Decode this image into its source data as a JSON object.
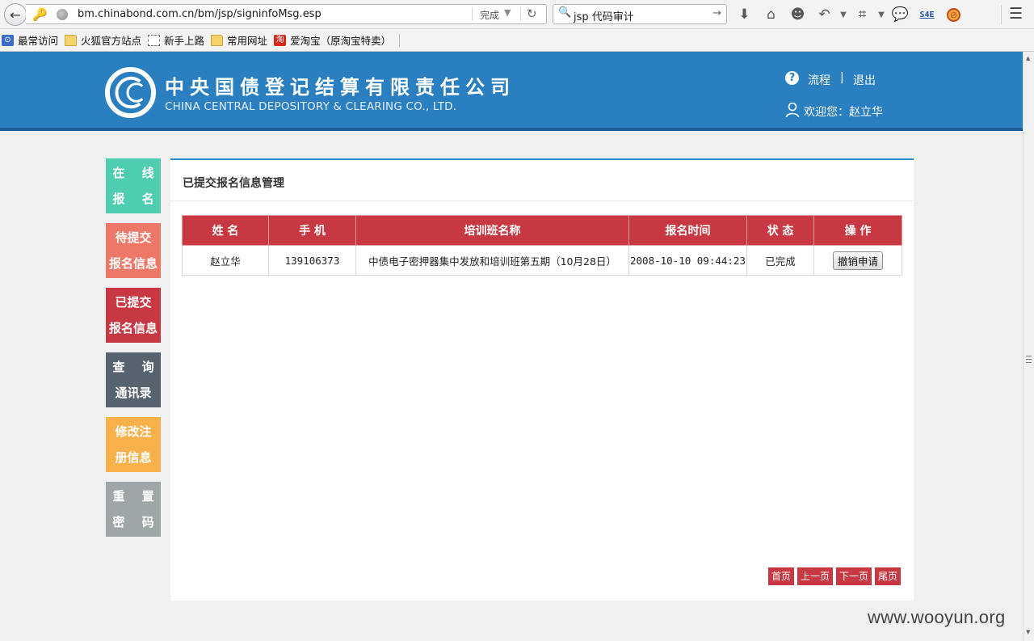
{
  "browser": {
    "url": "bm.chinabond.com.cn/bm/jsp/signinfoMsg.esp",
    "status": "完成",
    "search": "jsp 代码审计",
    "icons": [
      "download-icon",
      "home-icon",
      "chat-bubble-icon",
      "undo-icon",
      "crop-icon",
      "speech-icon",
      "s4e-icon",
      "adblock-icon",
      "menu-icon"
    ],
    "s4e_label": "S4E"
  },
  "bookmarks": [
    {
      "label": "最常访问",
      "icon": "most-visited-icon"
    },
    {
      "label": "火狐官方站点",
      "icon": "folder-icon"
    },
    {
      "label": "新手上路",
      "icon": "page-icon"
    },
    {
      "label": "常用网址",
      "icon": "folder-icon"
    },
    {
      "label": "爱淘宝（原淘宝特卖）",
      "icon": "taobao-icon"
    }
  ],
  "header": {
    "company_cn": "中央国债登记结算有限责任公司",
    "company_en": "CHINA CENTRAL DEPOSITORY & CLEARING CO., LTD.",
    "help_icon_text": "?",
    "flow_link": "流程",
    "pipe": "|",
    "logout_link": "退出",
    "welcome": "欢迎您：赵立华"
  },
  "sidebar": [
    {
      "line1": "在 线",
      "line2": "报 名",
      "color": "#4ecdb1"
    },
    {
      "line1": "待提交",
      "line2": "报名信息",
      "color": "#ee7867"
    },
    {
      "line1": "已提交",
      "line2": "报名信息",
      "color": "#c83843"
    },
    {
      "line1": "查 询",
      "line2": "通讯录",
      "color": "#56626d"
    },
    {
      "line1": "修改注",
      "line2": "册信息",
      "color": "#f8b04a"
    },
    {
      "line1": "重 置",
      "line2": "密 码",
      "color": "#9ea6a8"
    }
  ],
  "main": {
    "title": "已提交报名信息管理",
    "columns": [
      "姓 名",
      "手 机",
      "培训班名称",
      "报名时间",
      "状 态",
      "操 作"
    ],
    "rows": [
      {
        "name": "赵立华",
        "phone": "139106373",
        "course": "中债电子密押器集中发放和培训班第五期（10月28日）",
        "time": "2008-10-10 09:44:23",
        "status": "已完成",
        "action": "撤销申请"
      }
    ],
    "pager": {
      "first": "首页",
      "prev": "上一页",
      "next": "下一页",
      "last": "尾页"
    }
  },
  "watermark": "www.wooyun.org",
  "colors": {
    "header_blue": "#2a7fc0",
    "table_red": "#c83843",
    "panel_accent": "#2a8fd0"
  }
}
